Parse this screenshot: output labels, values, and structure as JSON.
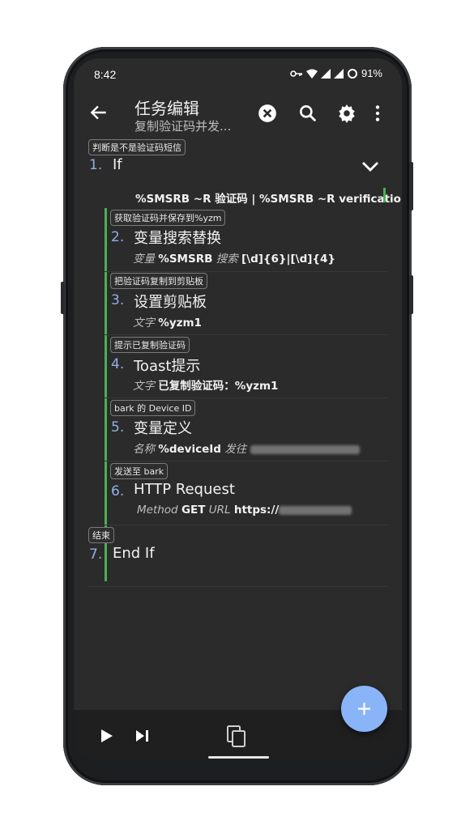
{
  "status": {
    "time": "8:42",
    "battery": "91%"
  },
  "toolbar": {
    "title": "任务编辑",
    "subtitle": "复制验证码并发..."
  },
  "actions": [
    {
      "label": "判断是不是验证码短信",
      "number": "1.",
      "name": "If",
      "condition": "%SMSRB ~R 验证码 | %SMSRB ~R verification"
    },
    {
      "label": "获取验证码并保存到%yzm",
      "number": "2.",
      "name": "变量搜索替换",
      "p1_key": "变量",
      "p1_val": "%SMSRB",
      "p2_key": "搜索",
      "p2_val": "[\\d]{6}|[\\d]{4}"
    },
    {
      "label": "把验证码复制到剪贴板",
      "number": "3.",
      "name": "设置剪贴板",
      "p1_key": "文字",
      "p1_val": "%yzm1"
    },
    {
      "label": "提示已复制验证码",
      "number": "4.",
      "name": "Toast提示",
      "p1_key": "文字",
      "p1_val": "已复制验证码：%yzm1"
    },
    {
      "label": "bark 的 Device ID",
      "number": "5.",
      "name": "变量定义",
      "p1_key": "名称",
      "p1_val": "%deviceId",
      "p2_key": "发往"
    },
    {
      "label": "发送至 bark",
      "number": "6.",
      "name": "HTTP Request",
      "p1_key": "Method",
      "p1_val": "GET",
      "p2_key": "URL",
      "p2_val": "https://"
    },
    {
      "label": "结束",
      "number": "7.",
      "name": "End If"
    }
  ]
}
